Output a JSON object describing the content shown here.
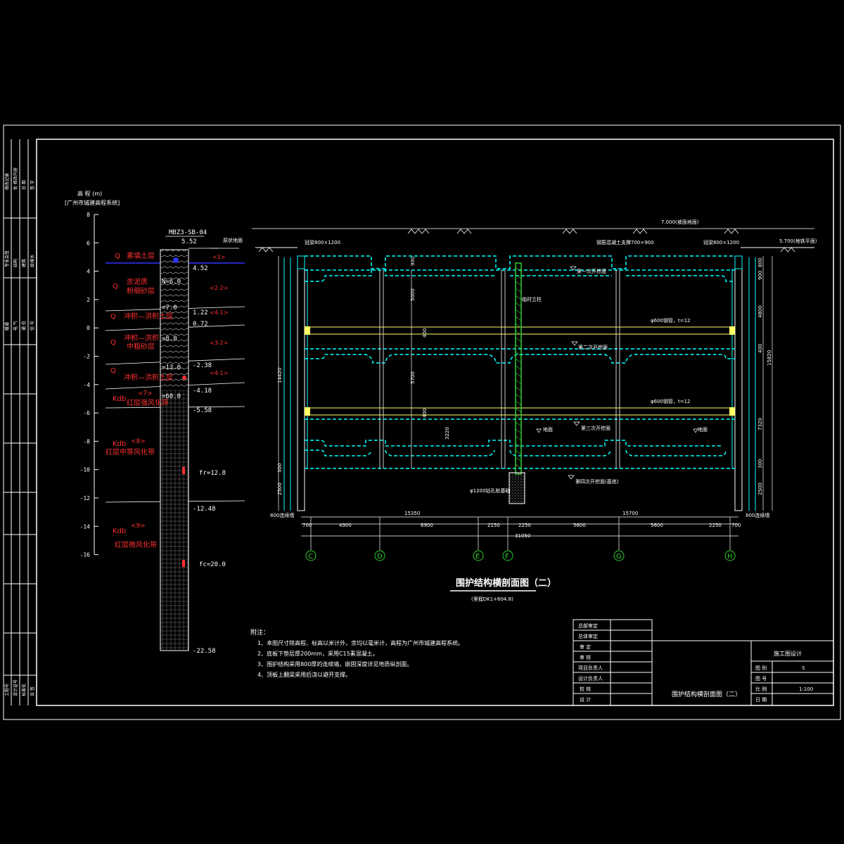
{
  "colors": {
    "background": "#000000",
    "line": "#ffffff",
    "structure": "#00ffff",
    "soil_label": "#ff3030",
    "strut": "#ffff66",
    "column": "#33cc33",
    "water": "#3333ff"
  },
  "elevation_axis": {
    "title": "高 程 (m)",
    "subtitle": "[广州市城建高程系统]",
    "ticks": [
      "8",
      "6",
      "4",
      "2",
      "0",
      "-2",
      "-4",
      "-6",
      "-8",
      "-10",
      "-12",
      "-14",
      "-16"
    ]
  },
  "borehole": {
    "id": "MBZ3-SB-04",
    "top_elev": "5.52",
    "surface_label": "原状地面",
    "values": {
      "n1": "N=6.0",
      "n2": "=7.0",
      "n3": "=8.0",
      "n4": "=13.0",
      "n5": "=60.0",
      "fr": "fr=12.8",
      "fc": "fc=20.0"
    },
    "layer_elevs": [
      "4.52",
      "1.22",
      "0.72",
      "-2.38",
      "-4.18",
      "-5.58",
      "-12.48",
      "-22.58"
    ]
  },
  "soil_layers": [
    {
      "code": "Q",
      "label": "素填土层",
      "tag": "<1>"
    },
    {
      "code": "Q",
      "label": "淤泥质",
      "label2": "粉细砂层",
      "tag": "<2-2>"
    },
    {
      "code": "Q",
      "label": "冲积—洪积土层",
      "tag": "<4-1>"
    },
    {
      "code": "Q",
      "label": "冲积—洪积",
      "label2": "中粗砂层",
      "tag": "<3-2>"
    },
    {
      "code": "Q",
      "label": "冲积—洪积土层",
      "tag": "<4-1>"
    },
    {
      "code": "Kdb",
      "label": "<7>",
      "label2": "红层强风化带"
    },
    {
      "code": "Kdb",
      "label": "<8>",
      "label2": "红层中等风化带"
    },
    {
      "code": "Kdb",
      "label": "<9>",
      "label2": "红层微风化带"
    }
  ],
  "section": {
    "surface_label": "7.000(坡面地面)",
    "right_label": "5.700(地铁平面)",
    "crown_left": "冠梁800×1200",
    "crown_right": "冠梁800×1200",
    "top_strut": "钢筋混凝土支撑700×900",
    "temp_column": "临时立柱",
    "strut1": "φ600钢管，t=12",
    "strut2": "φ600钢管，t=12",
    "exc1": "第一次开挖面",
    "exc2": "第二次开挖面",
    "exc3": "第三次开挖面",
    "exc4": "第四次开挖面(基底)",
    "water1": "地面",
    "water2": "地面",
    "pile": "φ1200钻孔桩基础",
    "wall_left": "800连续墙",
    "wall_right": "800连续墙",
    "left_dims": [
      "14420",
      "300",
      "2500"
    ],
    "inner_dims": [
      "900",
      "5000",
      "400",
      "5700",
      "400",
      "3220"
    ],
    "right_dims": [
      "800",
      "900",
      "4800",
      "15820",
      "400",
      "7320",
      "300",
      "2500"
    ],
    "bottom_dims_upper": [
      "15350",
      "15700"
    ],
    "bottom_dims": [
      "700",
      "4900",
      "6900",
      "2150",
      "2250",
      "5600",
      "5600",
      "2250",
      "700"
    ],
    "total_dim": "31050",
    "axes": [
      "C",
      "D",
      "E",
      "F",
      "G",
      "H"
    ],
    "title": "围护结构横剖面图（二）",
    "subtitle": "(里程DK1+604.8)"
  },
  "notes": {
    "heading": "附注：",
    "items": [
      "1、本图尺寸除高程、标高以米计外，余均以毫米计，高程为广州市城建高程系统。",
      "2、底板下垫层厚200mm，采用C15素混凝土。",
      "3、围护结构采用800厚的连续墙，嵌固深度详见地质纵剖面。",
      "4、顶板上翻梁采用后浇以避开支撑。"
    ]
  },
  "title_block": {
    "left_rows": [
      "总部审定",
      "总体审定",
      "审 定",
      "审 核",
      "项目负责人",
      "设计负责人",
      "校 核",
      "设 计"
    ],
    "stage": "施工图设计",
    "drawing_title": "围护结构横剖面图（二）",
    "right_rows": [
      {
        "label": "图 别",
        "value": "S"
      },
      {
        "label": "图 号",
        "value": ""
      },
      {
        "label": "比 例",
        "value": "1:100"
      },
      {
        "label": "日 期",
        "value": ""
      }
    ]
  },
  "side_strip": [
    "修改记录",
    "处 修改内容",
    "日 期",
    "签 字",
    "专业会签",
    "结构",
    "建筑",
    "给排水",
    "暖通",
    "电 气",
    "通 信",
    "信 号",
    "工程号",
    "设计证号",
    "标准化",
    "会 签"
  ]
}
